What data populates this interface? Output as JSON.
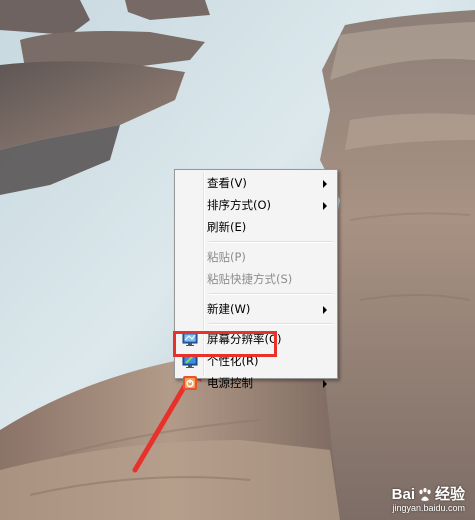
{
  "context_menu": {
    "items": [
      {
        "label": "查看(V)",
        "submenu": true,
        "disabled": false
      },
      {
        "label": "排序方式(O)",
        "submenu": true,
        "disabled": false
      },
      {
        "label": "刷新(E)",
        "submenu": false,
        "disabled": false
      },
      {
        "label": "粘贴(P)",
        "submenu": false,
        "disabled": true
      },
      {
        "label": "粘贴快捷方式(S)",
        "submenu": false,
        "disabled": true
      },
      {
        "label": "新建(W)",
        "submenu": true,
        "disabled": false
      },
      {
        "label": "屏幕分辨率(C)",
        "submenu": false,
        "disabled": false,
        "icon": "screen-resolution-icon"
      },
      {
        "label": "个性化(R)",
        "submenu": false,
        "disabled": false,
        "icon": "personalize-icon"
      },
      {
        "label": "电源控制",
        "submenu": true,
        "disabled": false,
        "icon": "power-control-icon"
      }
    ]
  },
  "annotation": {
    "highlight_color": "#e8312a",
    "highlighted_item": "个性化(R)"
  },
  "watermark": {
    "brand_left": "Bai",
    "brand_right": "经验",
    "url": "jingyan.baidu.com"
  },
  "colors": {
    "menu_background": "#f4f4f4",
    "disabled_text": "#8d8d8d"
  }
}
